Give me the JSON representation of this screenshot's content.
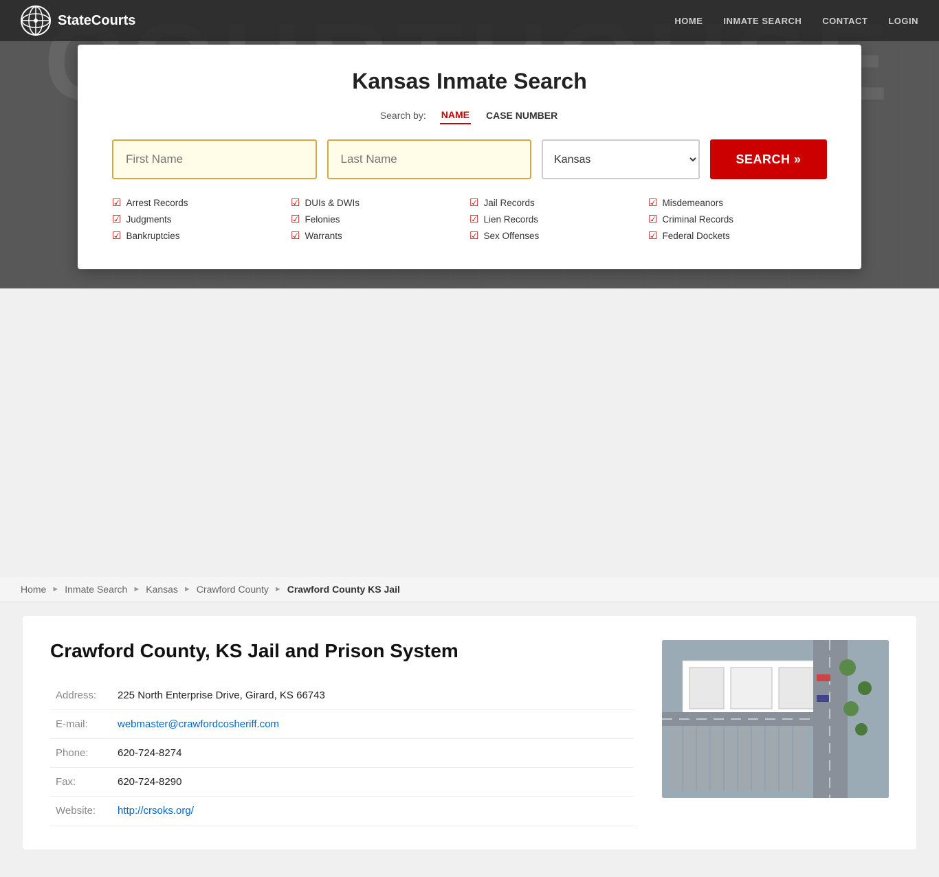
{
  "site": {
    "name": "StateCourts"
  },
  "nav": {
    "home": "HOME",
    "inmate_search": "INMATE SEARCH",
    "contact": "CONTACT",
    "login": "LOGIN"
  },
  "search_card": {
    "title": "Kansas Inmate Search",
    "search_by_label": "Search by:",
    "tab_name": "NAME",
    "tab_case_number": "CASE NUMBER",
    "first_name_placeholder": "First Name",
    "last_name_placeholder": "Last Name",
    "state_default": "Kansas",
    "search_button": "SEARCH »",
    "checklist": [
      "Arrest Records",
      "Judgments",
      "Bankruptcies",
      "DUIs & DWIs",
      "Felonies",
      "Warrants",
      "Jail Records",
      "Lien Records",
      "Sex Offenses",
      "Misdemeanors",
      "Criminal Records",
      "Federal Dockets"
    ]
  },
  "breadcrumb": {
    "home": "Home",
    "inmate_search": "Inmate Search",
    "kansas": "Kansas",
    "crawford_county": "Crawford County",
    "current": "Crawford County KS Jail"
  },
  "content": {
    "title": "Crawford County, KS Jail and Prison System",
    "address_label": "Address:",
    "address_value": "225 North Enterprise Drive, Girard, KS 66743",
    "email_label": "E-mail:",
    "email_value": "webmaster@crawfordcosheriff.com",
    "email_href": "mailto:webmaster@crawfordcosheriff.com",
    "phone_label": "Phone:",
    "phone_value": "620-724-8274",
    "fax_label": "Fax:",
    "fax_value": "620-724-8290",
    "website_label": "Website:",
    "website_value": "http://crsoks.org/",
    "website_href": "http://crsoks.org/"
  },
  "colors": {
    "accent": "#cc0000",
    "nav_bg": "#2a2a2a",
    "input_border": "#d4a843",
    "input_bg": "#fffce8"
  }
}
